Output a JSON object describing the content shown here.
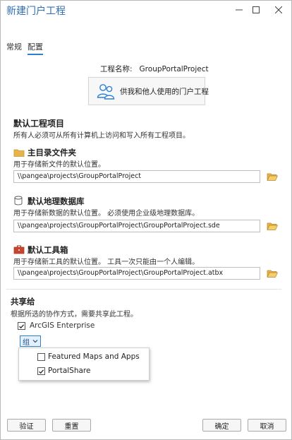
{
  "window": {
    "title": "新建门户工程",
    "minimize_icon": "minimize-icon",
    "maximize_icon": "maximize-icon",
    "close_icon": "close-icon"
  },
  "tabs": [
    {
      "label": "常规",
      "active": false
    },
    {
      "label": "配置",
      "active": true
    }
  ],
  "project": {
    "name_label": "工程名称:",
    "name_value": "GroupPortalProject",
    "share_type_label": "供我和他人使用的门户工程",
    "share_type_icon": "people-icon"
  },
  "defaults": {
    "heading": "默认工程项目",
    "description": "所有人必须可从所有计算机上访问和写入所有工程项目。",
    "home_folder": {
      "heading": "主目录文件夹",
      "description": "用于存储新文件的默认位置。",
      "path": "\\\\pangea\\projects\\GroupPortalProject",
      "icon": "folder-icon"
    },
    "geodatabase": {
      "heading": "默认地理数据库",
      "description": "用于存储新数据的默认位置。 必须使用企业级地理数据库。",
      "path": "\\\\pangea\\projects\\GroupPortalProject\\GroupPortalProject.sde",
      "icon": "database-icon"
    },
    "toolbox": {
      "heading": "默认工具箱",
      "description": "用于存储新工具的默认位置。 工具一次只能由一个人编辑。",
      "path": "\\\\pangea\\projects\\GroupPortalProject\\GroupPortalProject.atbx",
      "icon": "toolbox-icon"
    }
  },
  "share": {
    "heading": "共享给",
    "description": "根据所选的协作方式，需要共享此工程。",
    "enterprise_label": "ArcGIS Enterprise",
    "enterprise_checked": true,
    "group_button_label": "组",
    "groups": [
      {
        "label": "Featured Maps and Apps",
        "checked": false
      },
      {
        "label": "PortalShare",
        "checked": true
      }
    ]
  },
  "buttons": {
    "validate": "验证",
    "reset": "重置",
    "ok": "确定",
    "cancel": "取消"
  },
  "colors": {
    "accent": "#2d7fd3",
    "title": "#2f6fb3",
    "folder": "#e8b44a",
    "toolbox": "#c8462f"
  }
}
